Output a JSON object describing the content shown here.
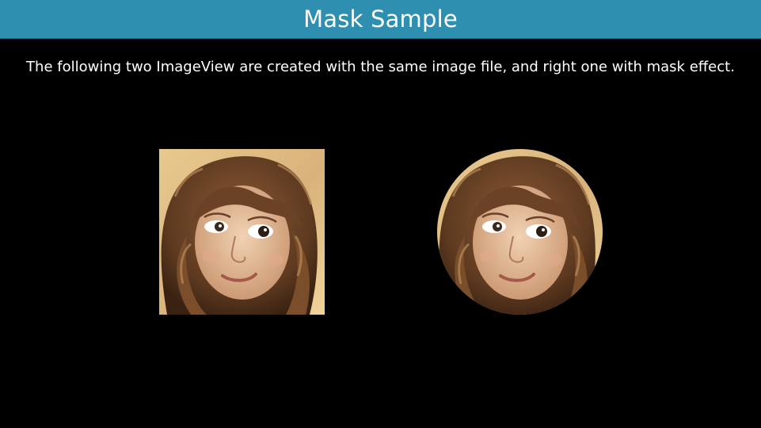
{
  "header": {
    "title": "Mask Sample"
  },
  "content": {
    "description": "The following two ImageView are created with the same image file, and right one with mask effect."
  },
  "images": {
    "normal": {
      "icon": "child-portrait-image",
      "mask": "none"
    },
    "masked": {
      "icon": "child-portrait-image",
      "mask": "circle"
    }
  },
  "colors": {
    "header_background": "#2e8fb0",
    "page_background": "#000000",
    "text": "#ffffff"
  }
}
